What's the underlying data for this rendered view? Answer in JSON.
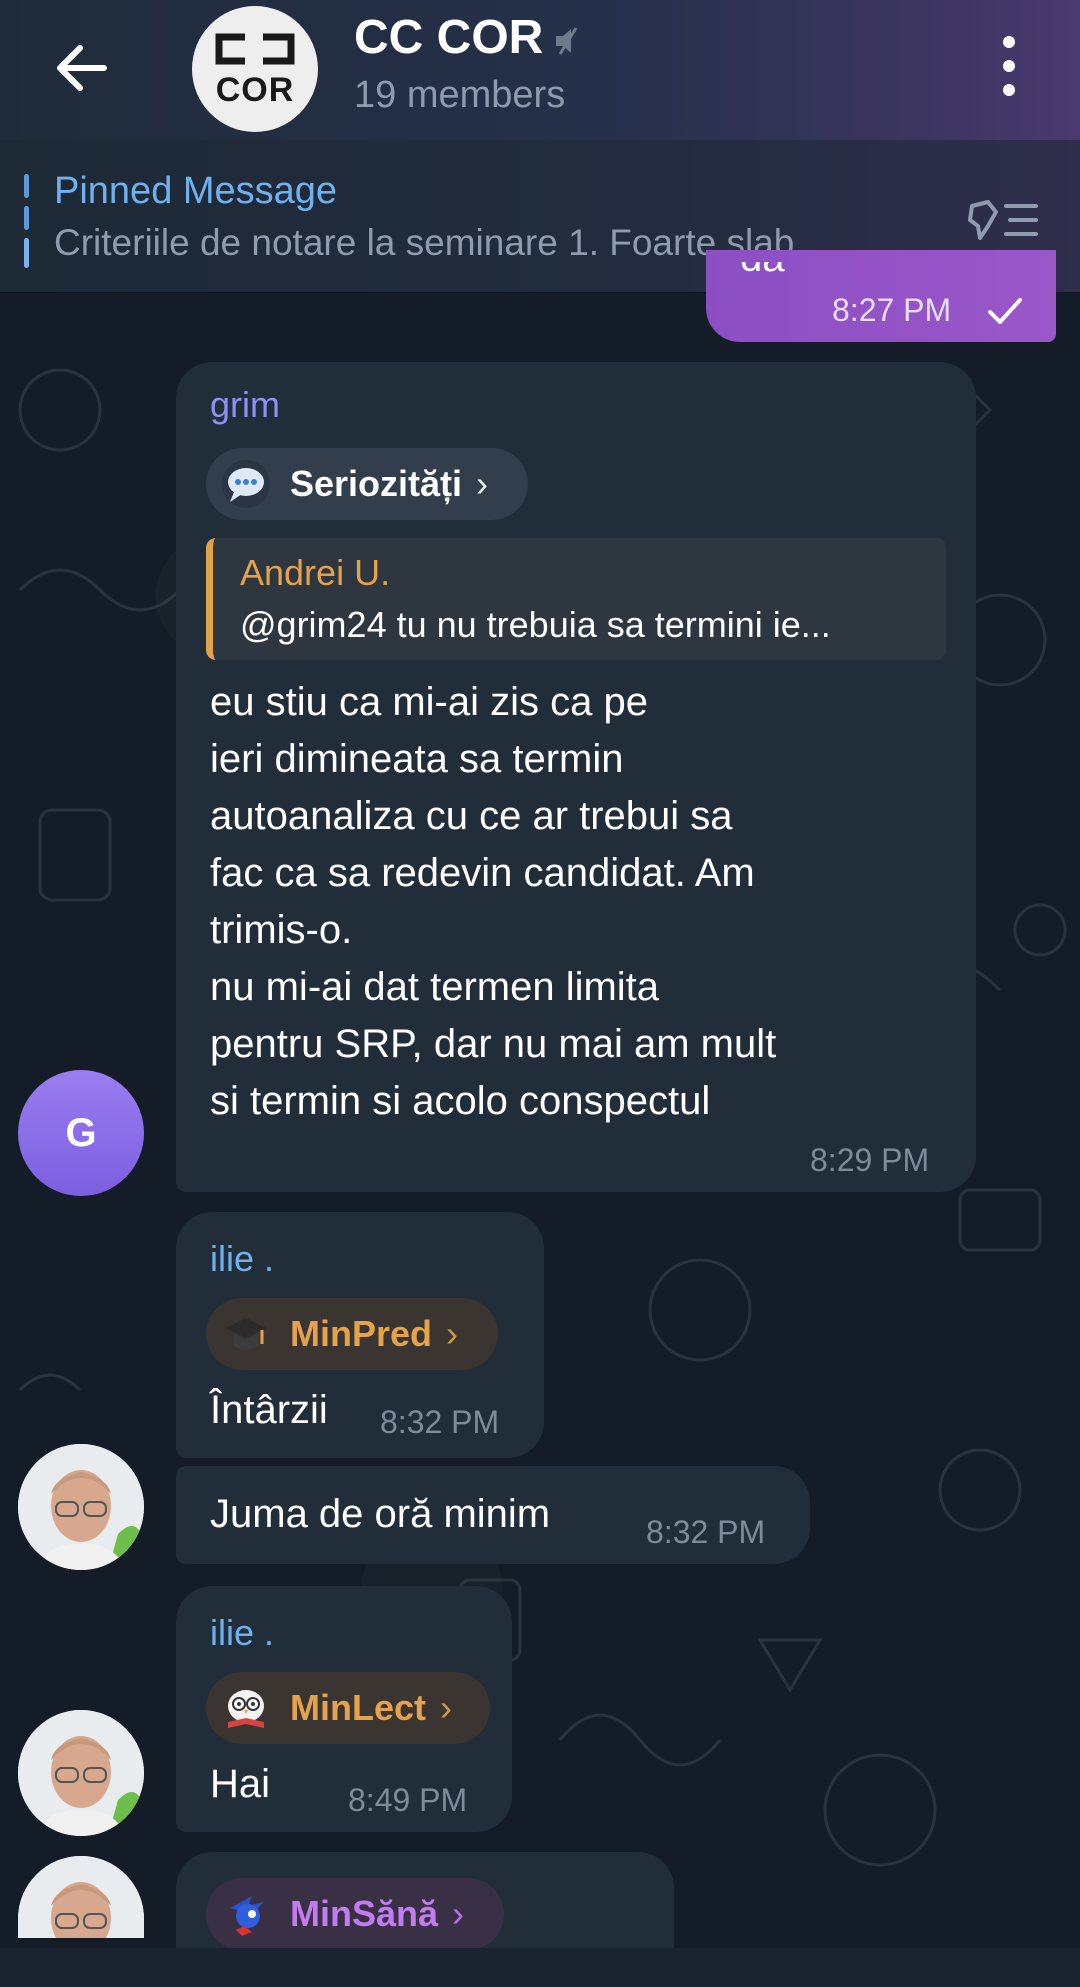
{
  "header": {
    "title": "CC COR",
    "subtitle": "19 members",
    "logo_text_top": "CJ",
    "logo_text_bottom": "COR"
  },
  "pinned": {
    "label": "Pinned Message",
    "text": "Criteriile de notare la seminare  1. Foarte slab..."
  },
  "outgoing_partial": {
    "text": "da",
    "time": "8:27 PM"
  },
  "messages": [
    {
      "sender": "grim",
      "sender_color": "#8f8ff5",
      "tag": "Seriozități",
      "tag_color": "#ffffff",
      "tag_emoji": "speech-bubble",
      "reply_author": "Andrei U.",
      "reply_text": "@grim24 tu nu trebuia sa termini ie...",
      "lines": [
        "eu stiu ca mi-ai zis ca pe",
        "ieri dimineata sa termin",
        "autoanaliza cu ce ar trebui sa",
        "fac ca sa redevin candidat. Am",
        "trimis-o.",
        "nu mi-ai dat termen limita",
        "pentru SRP, dar nu mai am mult",
        "si termin si acolo conspectul"
      ],
      "time": "8:29 PM",
      "avatar_letter": "G"
    },
    {
      "sender": "ilie .",
      "sender_color": "#6fb1ee",
      "tag": "MinPred",
      "tag_color": "#e3a24b",
      "tag_emoji": "graduation-cap",
      "text": "Întârzii",
      "time": "8:32 PM"
    },
    {
      "text": "Juma de oră minim",
      "time": "8:32 PM"
    },
    {
      "sender": "ilie .",
      "sender_color": "#6fb1ee",
      "tag": "MinLect",
      "tag_color": "#e3a24b",
      "tag_emoji": "owl-book",
      "text": "Hai",
      "time": "8:49 PM"
    },
    {
      "tag": "MinSănă",
      "tag_color": "#c27cf0",
      "tag_emoji": "sonic"
    }
  ],
  "colors": {
    "accent": "#6fb1ee",
    "bubble_in": "#222d3a",
    "bubble_out": "#9053c6"
  }
}
